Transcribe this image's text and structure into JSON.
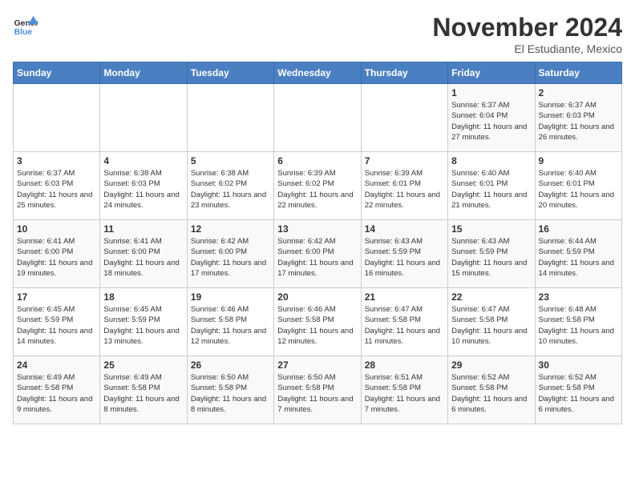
{
  "logo": {
    "line1": "General",
    "line2": "Blue"
  },
  "title": "November 2024",
  "location": "El Estudiante, Mexico",
  "days_header": [
    "Sunday",
    "Monday",
    "Tuesday",
    "Wednesday",
    "Thursday",
    "Friday",
    "Saturday"
  ],
  "weeks": [
    [
      {
        "day": "",
        "info": ""
      },
      {
        "day": "",
        "info": ""
      },
      {
        "day": "",
        "info": ""
      },
      {
        "day": "",
        "info": ""
      },
      {
        "day": "",
        "info": ""
      },
      {
        "day": "1",
        "info": "Sunrise: 6:37 AM\nSunset: 6:04 PM\nDaylight: 11 hours and 27 minutes."
      },
      {
        "day": "2",
        "info": "Sunrise: 6:37 AM\nSunset: 6:03 PM\nDaylight: 11 hours and 26 minutes."
      }
    ],
    [
      {
        "day": "3",
        "info": "Sunrise: 6:37 AM\nSunset: 6:03 PM\nDaylight: 11 hours and 25 minutes."
      },
      {
        "day": "4",
        "info": "Sunrise: 6:38 AM\nSunset: 6:03 PM\nDaylight: 11 hours and 24 minutes."
      },
      {
        "day": "5",
        "info": "Sunrise: 6:38 AM\nSunset: 6:02 PM\nDaylight: 11 hours and 23 minutes."
      },
      {
        "day": "6",
        "info": "Sunrise: 6:39 AM\nSunset: 6:02 PM\nDaylight: 11 hours and 22 minutes."
      },
      {
        "day": "7",
        "info": "Sunrise: 6:39 AM\nSunset: 6:01 PM\nDaylight: 11 hours and 22 minutes."
      },
      {
        "day": "8",
        "info": "Sunrise: 6:40 AM\nSunset: 6:01 PM\nDaylight: 11 hours and 21 minutes."
      },
      {
        "day": "9",
        "info": "Sunrise: 6:40 AM\nSunset: 6:01 PM\nDaylight: 11 hours and 20 minutes."
      }
    ],
    [
      {
        "day": "10",
        "info": "Sunrise: 6:41 AM\nSunset: 6:00 PM\nDaylight: 11 hours and 19 minutes."
      },
      {
        "day": "11",
        "info": "Sunrise: 6:41 AM\nSunset: 6:00 PM\nDaylight: 11 hours and 18 minutes."
      },
      {
        "day": "12",
        "info": "Sunrise: 6:42 AM\nSunset: 6:00 PM\nDaylight: 11 hours and 17 minutes."
      },
      {
        "day": "13",
        "info": "Sunrise: 6:42 AM\nSunset: 6:00 PM\nDaylight: 11 hours and 17 minutes."
      },
      {
        "day": "14",
        "info": "Sunrise: 6:43 AM\nSunset: 5:59 PM\nDaylight: 11 hours and 16 minutes."
      },
      {
        "day": "15",
        "info": "Sunrise: 6:43 AM\nSunset: 5:59 PM\nDaylight: 11 hours and 15 minutes."
      },
      {
        "day": "16",
        "info": "Sunrise: 6:44 AM\nSunset: 5:59 PM\nDaylight: 11 hours and 14 minutes."
      }
    ],
    [
      {
        "day": "17",
        "info": "Sunrise: 6:45 AM\nSunset: 5:59 PM\nDaylight: 11 hours and 14 minutes."
      },
      {
        "day": "18",
        "info": "Sunrise: 6:45 AM\nSunset: 5:59 PM\nDaylight: 11 hours and 13 minutes."
      },
      {
        "day": "19",
        "info": "Sunrise: 6:46 AM\nSunset: 5:58 PM\nDaylight: 11 hours and 12 minutes."
      },
      {
        "day": "20",
        "info": "Sunrise: 6:46 AM\nSunset: 5:58 PM\nDaylight: 11 hours and 12 minutes."
      },
      {
        "day": "21",
        "info": "Sunrise: 6:47 AM\nSunset: 5:58 PM\nDaylight: 11 hours and 11 minutes."
      },
      {
        "day": "22",
        "info": "Sunrise: 6:47 AM\nSunset: 5:58 PM\nDaylight: 11 hours and 10 minutes."
      },
      {
        "day": "23",
        "info": "Sunrise: 6:48 AM\nSunset: 5:58 PM\nDaylight: 11 hours and 10 minutes."
      }
    ],
    [
      {
        "day": "24",
        "info": "Sunrise: 6:49 AM\nSunset: 5:58 PM\nDaylight: 11 hours and 9 minutes."
      },
      {
        "day": "25",
        "info": "Sunrise: 6:49 AM\nSunset: 5:58 PM\nDaylight: 11 hours and 8 minutes."
      },
      {
        "day": "26",
        "info": "Sunrise: 6:50 AM\nSunset: 5:58 PM\nDaylight: 11 hours and 8 minutes."
      },
      {
        "day": "27",
        "info": "Sunrise: 6:50 AM\nSunset: 5:58 PM\nDaylight: 11 hours and 7 minutes."
      },
      {
        "day": "28",
        "info": "Sunrise: 6:51 AM\nSunset: 5:58 PM\nDaylight: 11 hours and 7 minutes."
      },
      {
        "day": "29",
        "info": "Sunrise: 6:52 AM\nSunset: 5:58 PM\nDaylight: 11 hours and 6 minutes."
      },
      {
        "day": "30",
        "info": "Sunrise: 6:52 AM\nSunset: 5:58 PM\nDaylight: 11 hours and 6 minutes."
      }
    ]
  ]
}
